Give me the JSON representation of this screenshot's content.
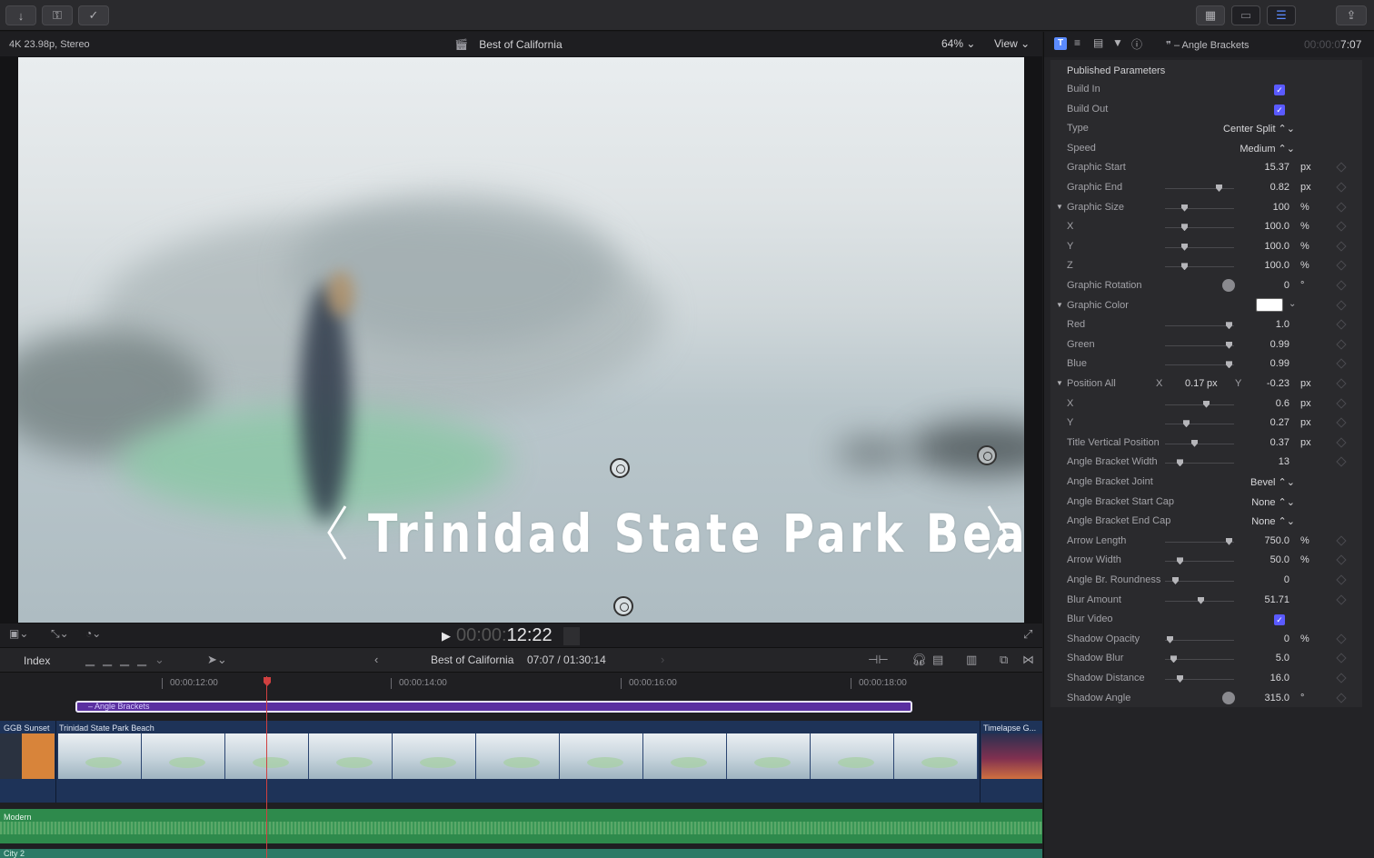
{
  "viewer": {
    "format": "4K 23.98p, Stereo",
    "title": "Best of California",
    "zoom": "64% ⌄",
    "view": "View ⌄",
    "overlay_title": "Trinidad State Park Beach"
  },
  "transport": {
    "timecode_dim": "00:00:",
    "timecode": "12:22"
  },
  "timeline": {
    "index_label": "Index",
    "project": "Best of California",
    "duration": "07:07 / 01:30:14",
    "ruler": [
      "00:00:12:00",
      "00:00:14:00",
      "00:00:16:00",
      "00:00:18:00"
    ],
    "title_clip": "– Angle Brackets",
    "clips": [
      "GGB Sunset",
      "Trinidad State Park Beach",
      "Timelapse G..."
    ],
    "audio": [
      "Modern",
      "City 2"
    ]
  },
  "inspector": {
    "clip_name": "– Angle Brackets",
    "timecode_dim": "00:00:0",
    "timecode": "7:07",
    "section": "Published Parameters",
    "rows": [
      {
        "label": "Build In",
        "kind": "check"
      },
      {
        "label": "Build Out",
        "kind": "check"
      },
      {
        "label": "Type",
        "kind": "popup",
        "value": "Center Split ⌃⌄"
      },
      {
        "label": "Speed",
        "kind": "popup",
        "value": "Medium ⌃⌄"
      },
      {
        "label": "Graphic Start",
        "kind": "num",
        "value": "15.37",
        "unit": "px"
      },
      {
        "label": "Graphic End",
        "kind": "slider",
        "value": "0.82",
        "unit": "px",
        "pos": 0.8
      },
      {
        "label": "Graphic Size",
        "kind": "slider",
        "value": "100",
        "unit": "%",
        "pos": 0.25,
        "group": true
      },
      {
        "label": "X",
        "kind": "slider",
        "value": "100.0",
        "unit": "%",
        "pos": 0.25
      },
      {
        "label": "Y",
        "kind": "slider",
        "value": "100.0",
        "unit": "%",
        "pos": 0.25
      },
      {
        "label": "Z",
        "kind": "slider",
        "value": "100.0",
        "unit": "%",
        "pos": 0.25
      },
      {
        "label": "Graphic Rotation",
        "kind": "dial",
        "value": "0",
        "unit": "°"
      },
      {
        "label": "Graphic Color",
        "kind": "color",
        "group": true
      },
      {
        "label": "Red",
        "kind": "slider",
        "value": "1.0",
        "unit": "",
        "pos": 0.95
      },
      {
        "label": "Green",
        "kind": "slider",
        "value": "0.99",
        "unit": "",
        "pos": 0.95
      },
      {
        "label": "Blue",
        "kind": "slider",
        "value": "0.99",
        "unit": "",
        "pos": 0.95
      },
      {
        "label": "Position All",
        "kind": "position",
        "group": true,
        "x_label": "X",
        "x_value": "0.17",
        "x_unit": "px",
        "y_label": "Y",
        "value": "-0.23",
        "unit": "px"
      },
      {
        "label": "X",
        "kind": "slider",
        "value": "0.6",
        "unit": "px",
        "pos": 0.6
      },
      {
        "label": "Y",
        "kind": "slider",
        "value": "0.27",
        "unit": "px",
        "pos": 0.28
      },
      {
        "label": "Title Vertical Position",
        "kind": "slider",
        "value": "0.37",
        "unit": "px",
        "pos": 0.42
      },
      {
        "label": "Angle Bracket Width",
        "kind": "slider",
        "value": "13",
        "unit": "",
        "pos": 0.18
      },
      {
        "label": "Angle Bracket Joint",
        "kind": "popup",
        "value": "Bevel ⌃⌄"
      },
      {
        "label": "Angle Bracket Start Cap",
        "kind": "popup",
        "value": "None ⌃⌄"
      },
      {
        "label": "Angle Bracket End Cap",
        "kind": "popup",
        "value": "None ⌃⌄"
      },
      {
        "label": "Arrow Length",
        "kind": "slider",
        "value": "750.0",
        "unit": "%",
        "pos": 0.95
      },
      {
        "label": "Arrow Width",
        "kind": "slider",
        "value": "50.0",
        "unit": "%",
        "pos": 0.18
      },
      {
        "label": "Angle Br. Roundness",
        "kind": "slider",
        "value": "0",
        "unit": "",
        "pos": 0.12
      },
      {
        "label": "Blur Amount",
        "kind": "slider",
        "value": "51.71",
        "unit": "",
        "pos": 0.52
      },
      {
        "label": "Blur Video",
        "kind": "check"
      },
      {
        "label": "Shadow Opacity",
        "kind": "slider",
        "value": "0",
        "unit": "%",
        "pos": 0.03
      },
      {
        "label": "Shadow Blur",
        "kind": "slider",
        "value": "5.0",
        "unit": "",
        "pos": 0.08
      },
      {
        "label": "Shadow Distance",
        "kind": "slider",
        "value": "16.0",
        "unit": "",
        "pos": 0.18
      },
      {
        "label": "Shadow Angle",
        "kind": "dial",
        "value": "315.0",
        "unit": "°"
      }
    ]
  },
  "colors": {
    "accent": "#5b8bff",
    "title_clip": "#5a2fa0",
    "main_track": "#1e3358",
    "audio": "#2e8a4c",
    "playhead": "#d04040"
  }
}
